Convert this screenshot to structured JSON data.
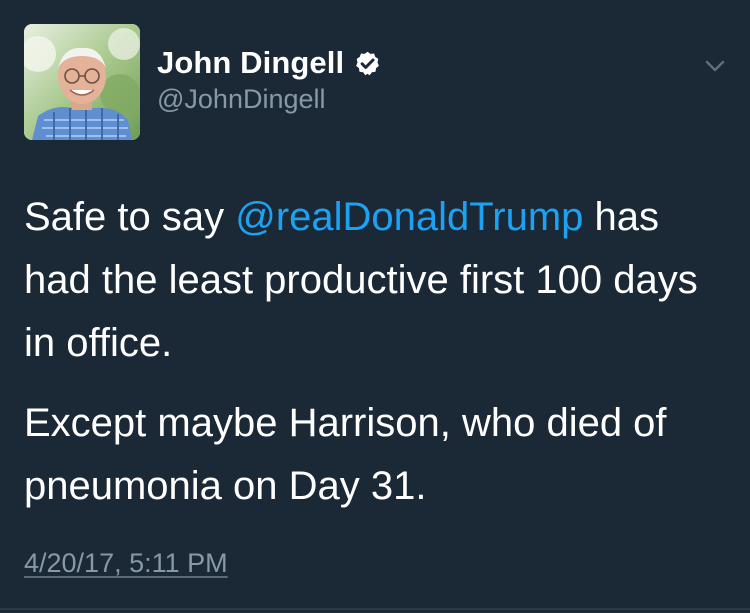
{
  "tweet": {
    "author": {
      "display_name": "John Dingell",
      "handle": "@JohnDingell",
      "verified": true
    },
    "text": {
      "p1_before": "Safe to say ",
      "p1_mention": "@realDonaldTrump",
      "p1_after": " has had the least productive first 100 days in office.",
      "p2": "Except maybe Harrison, who died of pneumonia on Day 31."
    },
    "timestamp": "4/20/17, 5:11 PM"
  },
  "colors": {
    "background": "#1b2836",
    "mention": "#1da1f2",
    "muted": "#8899a6"
  },
  "icons": {
    "verified": "verified-badge-icon",
    "menu": "chevron-down-icon"
  }
}
